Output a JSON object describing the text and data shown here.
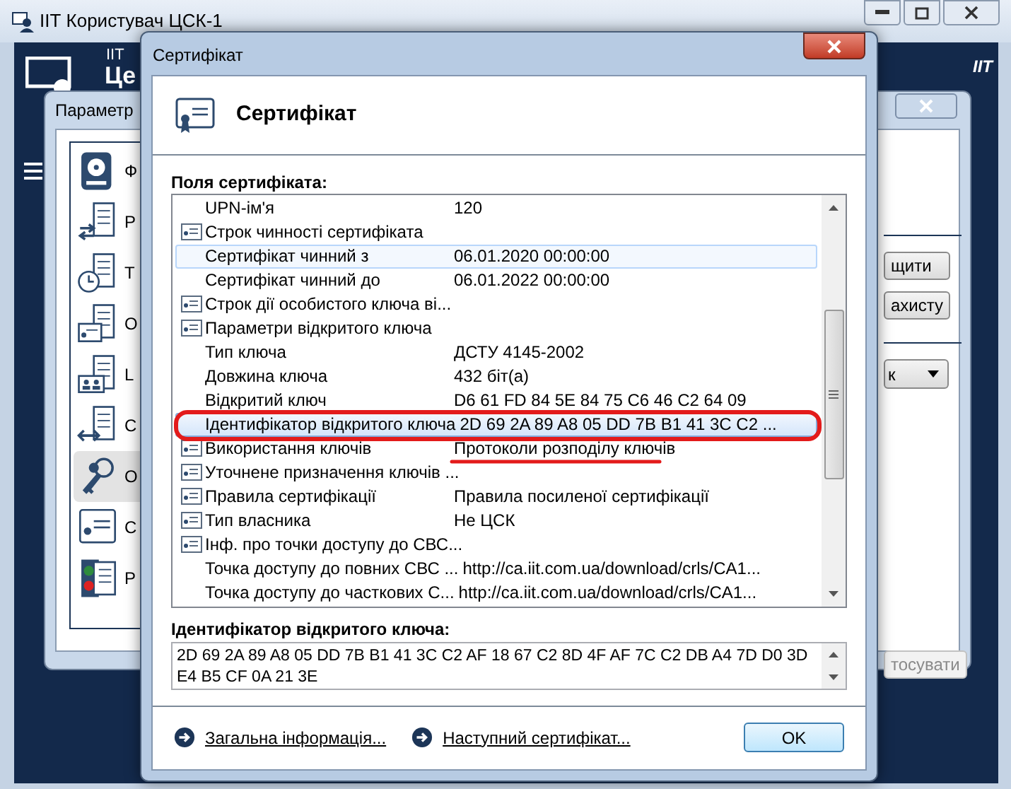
{
  "main_window": {
    "title": "ІІТ Користувач ЦСК-1",
    "brand": "IIT",
    "header_small": "IIT",
    "header_large": "Це"
  },
  "params_window": {
    "title": "Параметр",
    "sidebar": [
      {
        "kind": "disk",
        "label": "Ф",
        "selected": false
      },
      {
        "kind": "proxy",
        "label": "P",
        "selected": false
      },
      {
        "kind": "clock",
        "label": "T",
        "selected": false
      },
      {
        "kind": "cert-server",
        "label": "O",
        "selected": false
      },
      {
        "kind": "ldap",
        "label": "L",
        "selected": false
      },
      {
        "kind": "cmp",
        "label": "C",
        "selected": false
      },
      {
        "kind": "keys",
        "label": "О",
        "selected": true
      },
      {
        "kind": "cert",
        "label": "С",
        "selected": false
      },
      {
        "kind": "report",
        "label": "Р",
        "selected": false
      }
    ],
    "buttons": [
      {
        "label": "щити",
        "disabled": false
      },
      {
        "label": "ахисту",
        "disabled": false
      }
    ],
    "dropdown": {
      "value": "к"
    },
    "apply_button": {
      "label": "тосувати",
      "disabled": true
    }
  },
  "dialog": {
    "title": "Сертифікат",
    "heading": "Сертифікат",
    "fields_label": "Поля сертифіката:",
    "rows": [
      {
        "kind": "field",
        "name": "UPN-ім'я",
        "value": "120",
        "selected": false,
        "hovered": false,
        "circled": false,
        "underlined": false
      },
      {
        "kind": "group",
        "name": "Строк чинності сертифіката",
        "selected": false,
        "hovered": false,
        "circled": false,
        "underlined": false
      },
      {
        "kind": "field",
        "name": "Сертифікат чинний з",
        "value": "06.01.2020 00:00:00",
        "selected": false,
        "hovered": true,
        "circled": false,
        "underlined": false
      },
      {
        "kind": "field",
        "name": "Сертифікат чинний до",
        "value": "06.01.2022 00:00:00",
        "selected": false,
        "hovered": false,
        "circled": false,
        "underlined": false
      },
      {
        "kind": "group",
        "name": "Строк дії особистого ключа ві...",
        "selected": false,
        "hovered": false,
        "circled": false,
        "underlined": false
      },
      {
        "kind": "group",
        "name": "Параметри відкритого ключа",
        "selected": false,
        "hovered": false,
        "circled": false,
        "underlined": false
      },
      {
        "kind": "field",
        "name": "Тип ключа",
        "value": "ДСТУ 4145-2002",
        "selected": false,
        "hovered": false,
        "circled": false,
        "underlined": false
      },
      {
        "kind": "field",
        "name": "Довжина ключа",
        "value": "432 біт(а)",
        "selected": false,
        "hovered": false,
        "circled": false,
        "underlined": false
      },
      {
        "kind": "field",
        "name": "Відкритий ключ",
        "value": "D6 61 FD 84 5E 84 75 C6 46 C2 64 09",
        "selected": false,
        "hovered": false,
        "circled": false,
        "underlined": false
      },
      {
        "kind": "field",
        "name": "Ідентифікатор відкритого ключа",
        "value": "2D 69 2A 89 A8 05 DD 7B B1 41 3C C2 ...",
        "selected": true,
        "hovered": false,
        "circled": true,
        "underlined": false
      },
      {
        "kind": "group",
        "name": "Використання ключів",
        "value": "Протоколи розподілу ключів",
        "selected": false,
        "hovered": false,
        "circled": false,
        "underlined": true
      },
      {
        "kind": "group",
        "name": "Уточнене призначення ключів ...",
        "selected": false,
        "hovered": false,
        "circled": false,
        "underlined": false
      },
      {
        "kind": "group",
        "name": "Правила сертифікації",
        "value": "Правила посиленої сертифікації",
        "selected": false,
        "hovered": false,
        "circled": false,
        "underlined": false
      },
      {
        "kind": "group",
        "name": "Тип власника",
        "value": "Не ЦСК",
        "selected": false,
        "hovered": false,
        "circled": false,
        "underlined": false
      },
      {
        "kind": "group",
        "name": "Інф. про точки доступу до СВС...",
        "selected": false,
        "hovered": false,
        "circled": false,
        "underlined": false
      },
      {
        "kind": "field",
        "name": "Точка доступу до повних СВС ...",
        "value": "http://ca.iit.com.ua/download/crls/CA1...",
        "selected": false,
        "hovered": false,
        "circled": false,
        "underlined": false
      },
      {
        "kind": "field",
        "name": "Точка доступу до часткових С...",
        "value": "http://ca.iit.com.ua/download/crls/CA1...",
        "selected": false,
        "hovered": false,
        "circled": false,
        "underlined": false
      }
    ],
    "detail_label": "Ідентифікатор відкритого ключа:",
    "detail_value": "2D 69 2A 89 A8 05 DD 7B B1 41 3C C2 AF 18 67 C2 8D 4F AF 7C C2 DB A4 7D D0 3D E4 B5 CF 0A 21 3E",
    "links": [
      "Загальна інформація...",
      "Наступний сертифікат..."
    ],
    "ok_button": "OK"
  }
}
